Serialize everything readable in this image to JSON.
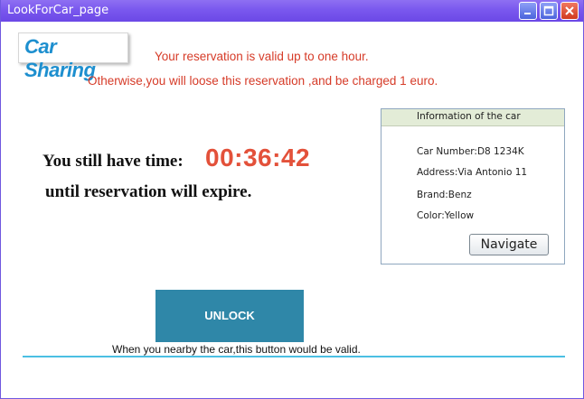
{
  "window": {
    "title": "LookForCar_page",
    "controls": {
      "minimize_icon": "minimize-icon",
      "maximize_icon": "maximize-icon",
      "close_icon": "close-icon"
    }
  },
  "header": {
    "logo_text": "Car Sharing",
    "notice_line1": "Your reservation is valid up to one hour.",
    "notice_line2": "Otherwise,you will loose this reservation ,and be charged 1 euro."
  },
  "timer": {
    "label": "You still have time:",
    "countdown": "00:36:42",
    "expire_text": "until reservation will expire."
  },
  "car_info": {
    "title": "Information of the car",
    "car_number": "Car Number:D8 1234K",
    "address": "Address:Via Antonio 11",
    "brand": "Brand:Benz",
    "color": "Color:Yellow",
    "navigate_label": "Navigate"
  },
  "unlock": {
    "label": "UNLOCK",
    "hint": "When you nearby the car,this button would be valid."
  },
  "colors": {
    "titlebar": "#7a58ee",
    "notice_text": "#d63b28",
    "countdown": "#e3513a",
    "unlock_button": "#2f87a8",
    "divider": "#4bbfe3",
    "logo_text": "#1d8fcf"
  }
}
